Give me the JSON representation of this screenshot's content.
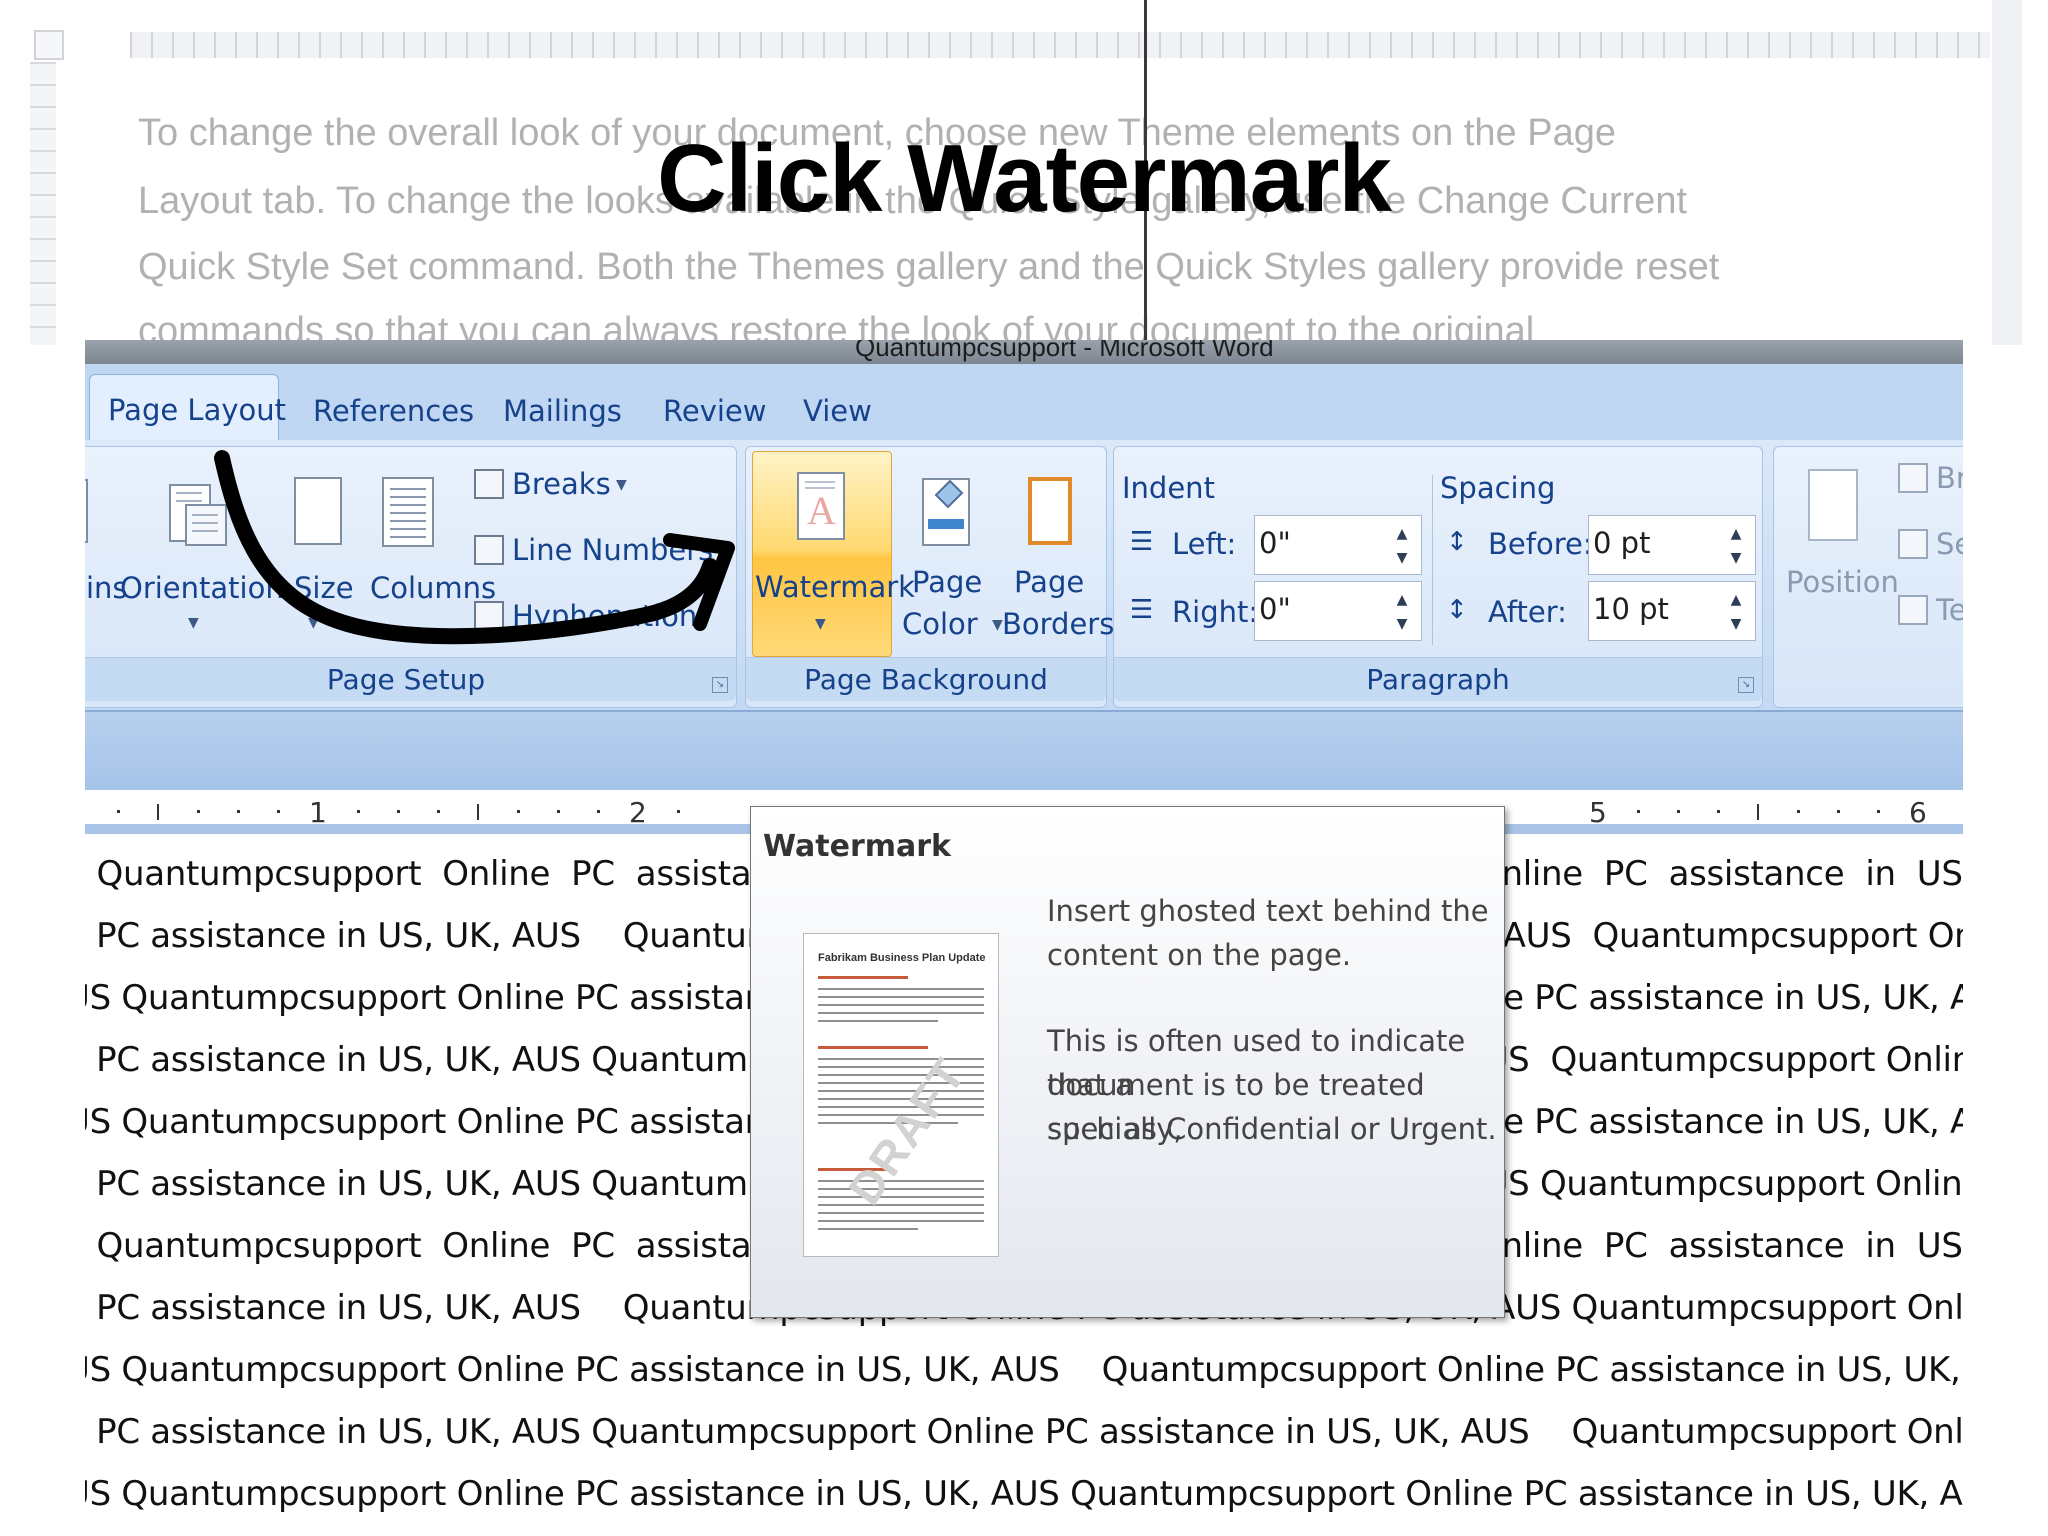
{
  "slide": {
    "title": "Click Watermark"
  },
  "background_doc": {
    "lines": [
      "To change the overall look of your document, choose new Theme elements on the Page",
      "Layout tab. To change the looks available in the Quick Style gallery, use the Change Current",
      "Quick Style Set command. Both the Themes gallery and the Quick Styles gallery provide reset",
      "commands so that you can always restore the look of your document to the original"
    ]
  },
  "window": {
    "title": "Quantumpcsupport - Microsoft Word"
  },
  "tabs": [
    {
      "label": "Page Layout",
      "active": true
    },
    {
      "label": "References"
    },
    {
      "label": "Mailings"
    },
    {
      "label": "Review"
    },
    {
      "label": "View"
    }
  ],
  "page_setup": {
    "group_label": "Page Setup",
    "margins_partial": "ins",
    "orientation": "Orientation",
    "size": "Size",
    "columns": "Columns",
    "breaks": "Breaks",
    "line_numbers": "Line Numbers",
    "hyphenation": "Hyphenation"
  },
  "page_background": {
    "group_label": "Page Background",
    "watermark": "Watermark",
    "page_color_1": "Page",
    "page_color_2": "Color",
    "page_borders_1": "Page",
    "page_borders_2": "Borders"
  },
  "paragraph": {
    "group_label": "Paragraph",
    "indent_label": "Indent",
    "left_label": "Left:",
    "left_value": "0\"",
    "right_label": "Right:",
    "right_value": "0\"",
    "spacing_label": "Spacing",
    "before_label": "Before:",
    "before_value": "0 pt",
    "after_label": "After:",
    "after_value": "10 pt"
  },
  "arrange": {
    "position": "Position",
    "bring_partial": "Br",
    "send_partial": "Se",
    "text_wrap_partial": "Te"
  },
  "ruler": {
    "numbers": [
      "1",
      "2",
      "5",
      "6"
    ]
  },
  "document_lines": [
    "   Quantumpcsupport  Online  PC  assistance  in  US,  UK,  AUS  Quantumpcsupport  Online  PC  assistance  in  US,  UK,  AUS  Quantumpc",
    "e PC assistance in US, UK, AUS    Quantumpcsupport  Online PC assistance in US, UK, AUS  Quantumpcsupport Online PC assistanc",
    "US Quantumpcsupport Online PC assistance in US, UK, AUS  Quantumpcsupport Online PC assistance in US, UK, AUS Quantumpc",
    "e PC assistance in US, UK, AUS Quantumpcsupport Online PC assistance in US, UK, AUS  Quantumpcsupport Online PC assistanc",
    "US Quantumpcsupport Online PC assistance in US, UK, AUS  Quantumpcsupport Online PC assistance in US, UK, AUS    Quantumpc",
    "e PC assistance in US, UK, AUS Quantumpcsupport Online PC assistance in US, UK, AUS Quantumpcsupport Online PC assistance in",
    "   Quantumpcsupport  Online  PC  assistance  in  US,  UK,  AUS  Quantumpcsupport  Online  PC  assistance  in  US,  UK,  AUS  Quantumpc",
    "e PC assistance in US, UK, AUS    Quantumpcsupport Online PC assistance in US, UK, AUS Quantumpcsupport Online PC assistanc",
    "US Quantumpcsupport Online PC assistance in US, UK, AUS    Quantumpcsupport Online PC assistance in US, UK, AUS Quantumpc",
    "e PC assistance in US, UK, AUS Quantumpcsupport Online PC assistance in US, UK, AUS    Quantumpcsupport Online PC assistanc",
    "US Quantumpcsupport Online PC assistance in US, UK, AUS Quantumpcsupport Online PC assistance in US, UK, AUS    Quantumpc"
  ],
  "tooltip": {
    "title": "Watermark",
    "thumb_heading": "Fabrikam Business Plan Update",
    "thumb_watermark": "DRAFT",
    "line1": "Insert ghosted text behind the",
    "line2": "content on the page.",
    "line3": "This is often used to indicate that a",
    "line4": "document is to be treated specially,",
    "line5": "such as Confidential or Urgent."
  },
  "colors": {
    "tab_text": "#15428b",
    "ribbon_bg": "#c3d9f3",
    "watermark_highlight": "#ffc542",
    "arrow": "#000000"
  }
}
